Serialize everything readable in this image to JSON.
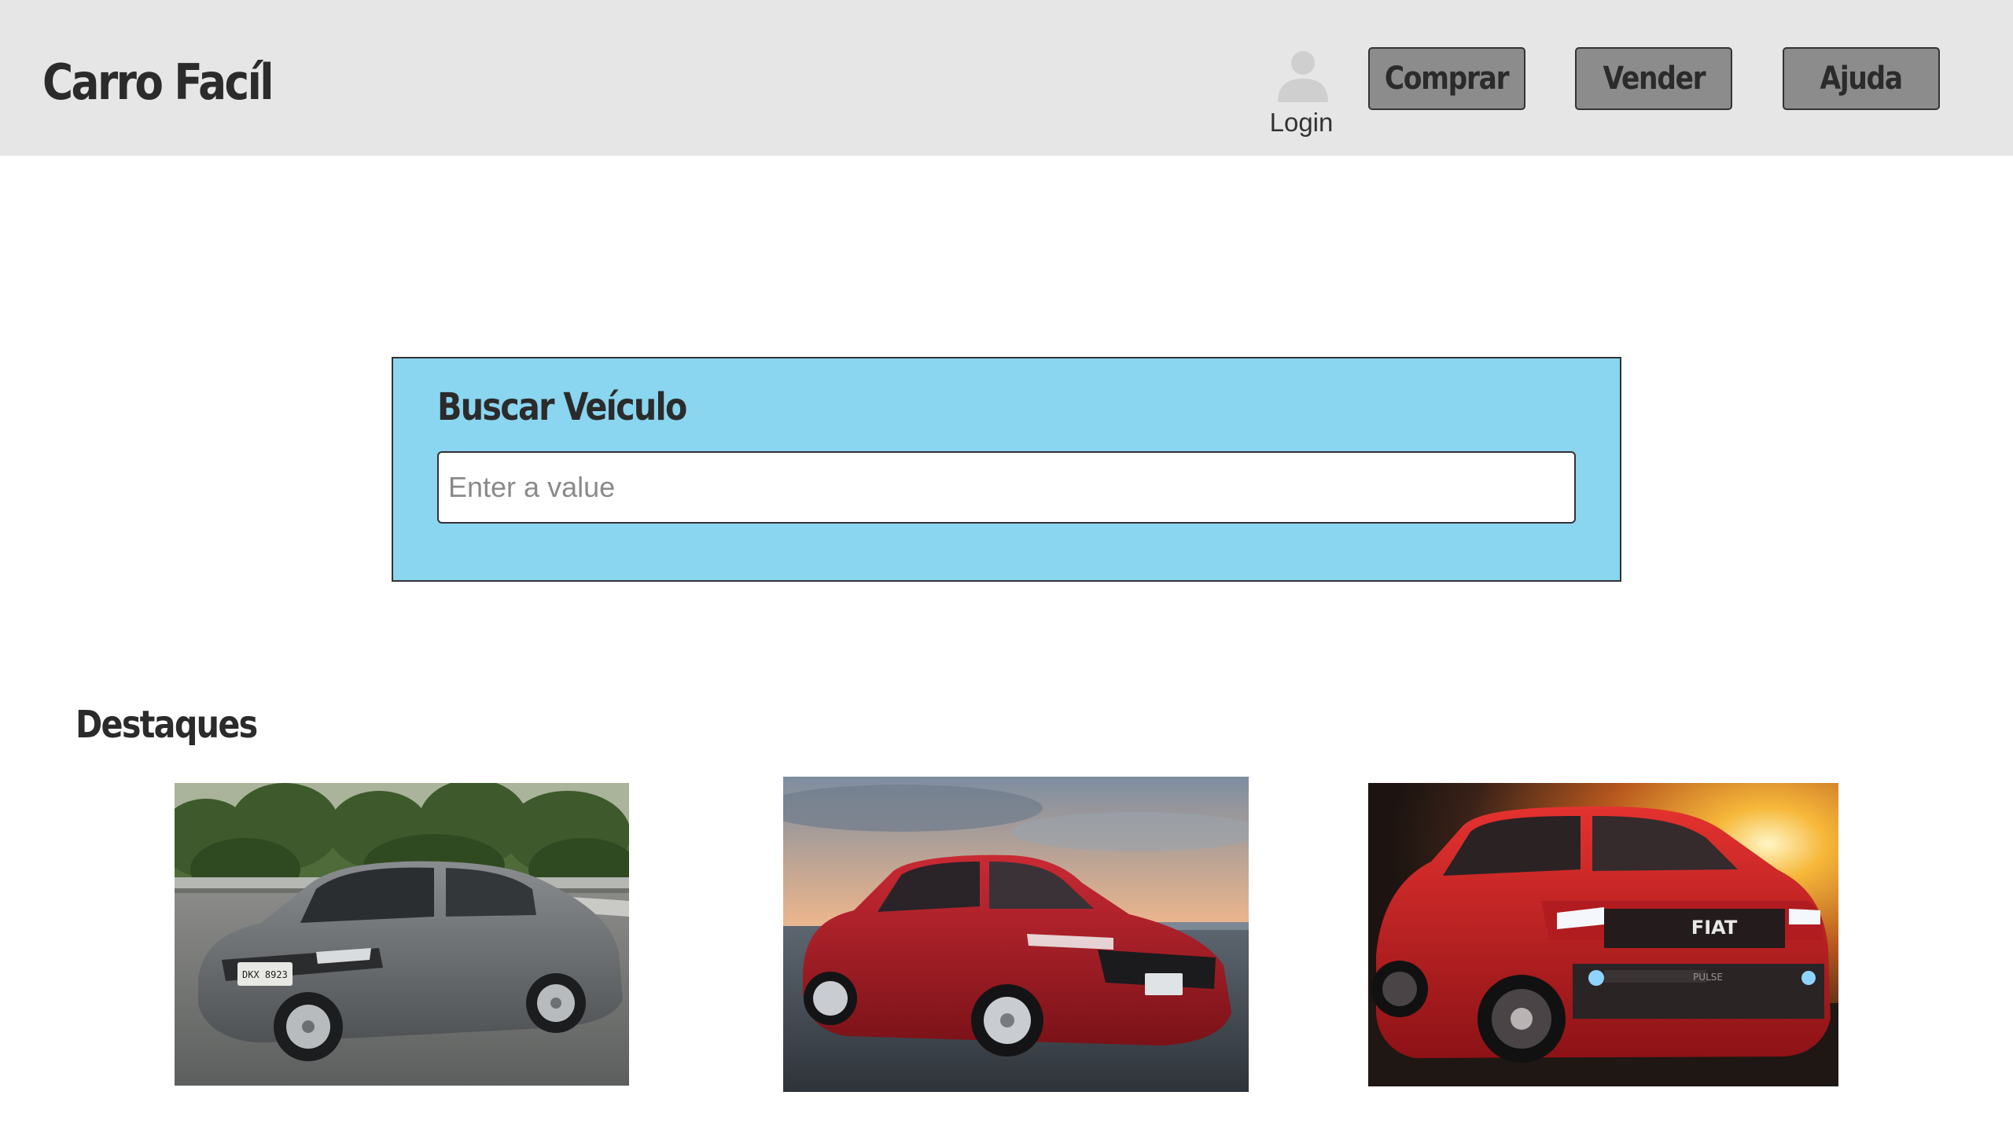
{
  "header": {
    "brand": "Carro Facíl",
    "login_label": "Login",
    "nav": {
      "buy_label": "Comprar",
      "sell_label": "Vender",
      "help_label": "Ajuda"
    }
  },
  "search": {
    "title": "Buscar Veículo",
    "placeholder": "Enter a value",
    "value": ""
  },
  "featured": {
    "title": "Destaques",
    "cars": [
      {
        "image": "gray-sedan-photo",
        "color": "#6d7073",
        "plate_text": "DKX 8923"
      },
      {
        "image": "red-hatchback-photo",
        "color": "#b3202a"
      },
      {
        "image": "red-suv-photo",
        "color": "#d01f24",
        "badge_text": "FIAT",
        "model_text": "PULSE"
      }
    ]
  },
  "colors": {
    "header_bg": "#e6e6e6",
    "nav_button_bg": "#8c8c8c",
    "search_panel_bg": "#8ad5f0",
    "text_dark": "#2b2b2b"
  }
}
